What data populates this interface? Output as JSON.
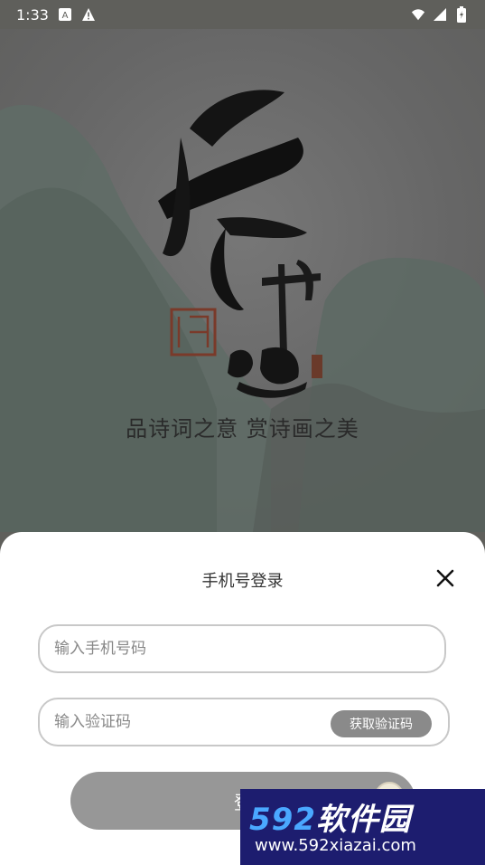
{
  "status_bar": {
    "time": "1:33",
    "icons": [
      "notification-a-icon",
      "warning-icon",
      "wifi-icon",
      "signal-icon",
      "battery-icon"
    ]
  },
  "hero": {
    "logo_text": "长相思",
    "tagline": "品诗词之意 赏诗画之美"
  },
  "login_sheet": {
    "title": "手机号登录",
    "phone_placeholder": "输入手机号码",
    "code_placeholder": "输入验证码",
    "get_code_label": "获取验证码",
    "login_label": "登"
  },
  "watermark": {
    "brand_num": "592",
    "brand_name": "软件园",
    "url": "www.592xiazai.com"
  }
}
